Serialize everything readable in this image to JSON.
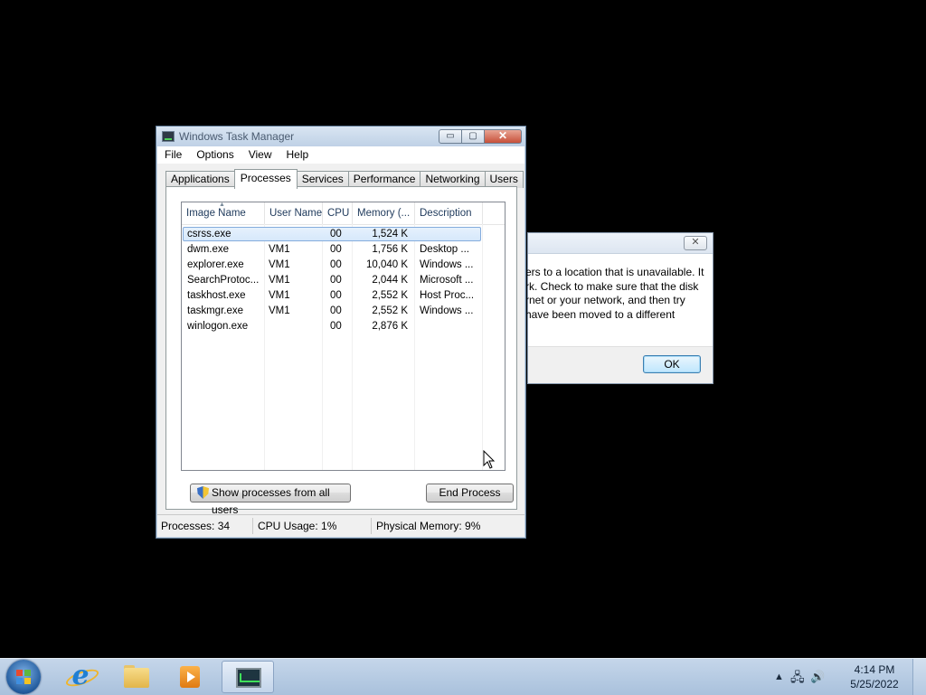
{
  "error_dialog": {
    "close_glyph": "✕",
    "message_lines": [
      "ers to a location that is unavailable. It",
      "rk. Check to make sure that the disk",
      "rnet or your network, and then try",
      "have been moved to a different"
    ],
    "ok_label": "OK"
  },
  "task_manager": {
    "title": "Windows Task Manager",
    "window_buttons": {
      "minimize": "▭",
      "maximize": "▢",
      "close": "✕"
    },
    "menu": [
      "File",
      "Options",
      "View",
      "Help"
    ],
    "tabs": [
      "Applications",
      "Processes",
      "Services",
      "Performance",
      "Networking",
      "Users"
    ],
    "active_tab": "Processes",
    "columns": [
      "Image Name",
      "User Name",
      "CPU",
      "Memory (...",
      "Description"
    ],
    "sort_indicator": "▲",
    "processes": [
      {
        "name": "csrss.exe",
        "user": "",
        "cpu": "00",
        "memory": "1,524 K",
        "description": ""
      },
      {
        "name": "dwm.exe",
        "user": "VM1",
        "cpu": "00",
        "memory": "1,756 K",
        "description": "Desktop ..."
      },
      {
        "name": "explorer.exe",
        "user": "VM1",
        "cpu": "00",
        "memory": "10,040 K",
        "description": "Windows ..."
      },
      {
        "name": "SearchProtoc...",
        "user": "VM1",
        "cpu": "00",
        "memory": "2,044 K",
        "description": "Microsoft ..."
      },
      {
        "name": "taskhost.exe",
        "user": "VM1",
        "cpu": "00",
        "memory": "2,552 K",
        "description": "Host Proc..."
      },
      {
        "name": "taskmgr.exe",
        "user": "VM1",
        "cpu": "00",
        "memory": "2,552 K",
        "description": "Windows ..."
      },
      {
        "name": "winlogon.exe",
        "user": "",
        "cpu": "00",
        "memory": "2,876 K",
        "description": ""
      }
    ],
    "selected_row": 0,
    "show_all_label": "Show processes from all users",
    "end_process_label": "End Process",
    "status": {
      "processes": "Processes: 34",
      "cpu": "CPU Usage: 1%",
      "memory": "Physical Memory: 9%"
    }
  },
  "taskbar": {
    "icons": [
      "start-orb",
      "internet-explorer",
      "windows-explorer",
      "media-player",
      "task-manager"
    ],
    "clock_time": "4:14 PM",
    "clock_date": "5/25/2022",
    "tray_glyphs": {
      "arrow": "▲",
      "network": "🖧",
      "volume": "🔊"
    }
  },
  "colors": {
    "desktop": "#000000",
    "selection": "#d6e8fb",
    "close_button": "#c7503a"
  }
}
